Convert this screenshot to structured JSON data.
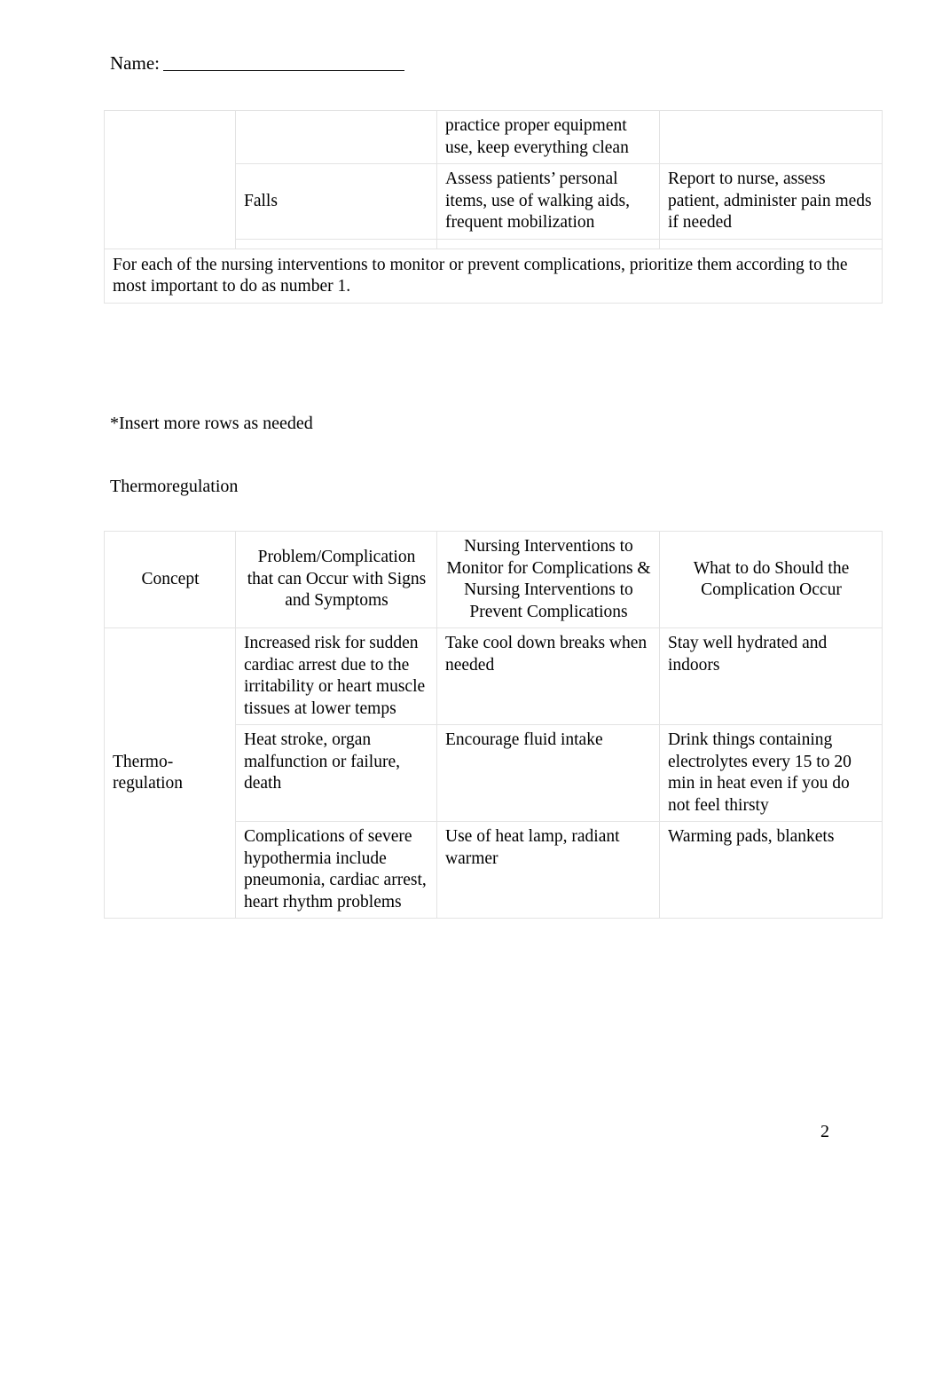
{
  "document": {
    "name_label": "Name:",
    "page_number": "2",
    "note_insert_rows": "*Insert more rows as needed",
    "section_heading": "Thermoregulation"
  },
  "table_one": {
    "rows": [
      {
        "concept": "",
        "problem": "",
        "interventions": "practice proper equipment use, keep everything clean",
        "what_to_do": ""
      },
      {
        "concept": "",
        "problem": "Falls",
        "interventions": "Assess patients’ personal items, use of walking aids, frequent mobilization",
        "what_to_do": "Report to nurse, assess patient, administer pain meds if needed"
      },
      {
        "concept": "",
        "problem": "",
        "interventions": "",
        "what_to_do": ""
      }
    ],
    "footer_note": "For each of the nursing interventions to monitor or prevent complications, prioritize them according to the most important to do as number 1."
  },
  "table_two": {
    "headers": {
      "concept": "Concept",
      "problem": "Problem/Complication that can Occur with Signs and Symptoms",
      "interventions": "Nursing Interventions to Monitor for Complications & Nursing Interventions to Prevent Complications",
      "what_to_do": "What to do Should the Complication Occur"
    },
    "rows": [
      {
        "concept": "Thermo-regulation",
        "problem": "Increased risk for sudden cardiac arrest due to the irritability or heart muscle tissues at lower temps",
        "interventions": "Take cool down breaks when needed",
        "what_to_do": "Stay well hydrated and indoors"
      },
      {
        "concept": "",
        "problem": "Heat stroke, organ malfunction or failure, death",
        "interventions": "Encourage fluid intake",
        "what_to_do": "Drink things containing electrolytes every 15 to 20 min in heat even if you do not feel thirsty"
      },
      {
        "concept": "",
        "problem": "Complications of severe hypothermia include pneumonia, cardiac arrest, heart rhythm problems",
        "interventions": "Use of heat lamp, radiant warmer",
        "what_to_do": "Warming pads, blankets"
      }
    ]
  }
}
